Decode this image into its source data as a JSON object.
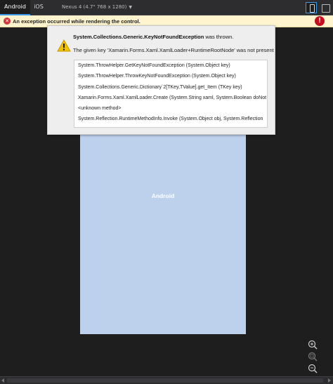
{
  "tabs": {
    "android": "Android",
    "ios": "iOS"
  },
  "device_selector": {
    "value": "Nexus 4 (4.7\" 768 x 1280)"
  },
  "banner": {
    "message": "An exception occurred while rendering the control."
  },
  "dialog": {
    "exception_type": "System.Collections.Generic.KeyNotFoundException",
    "title_suffix": " was thrown.",
    "message": "The given key 'Xamarin.Forms.Xaml.XamlLoader+RuntimeRootNode' was not present",
    "stack_trace": [
      "System.ThrowHelper.GetKeyNotFoundException (System.Object key)",
      "System.ThrowHelper.ThrowKeyNotFoundException (System.Object key)",
      "System.Collections.Generic.Dictionary`2[TKey,TValue].get_Item (TKey key)",
      "Xamarin.Forms.Xaml.XamlLoader.Create (System.String xaml, System.Boolean doNot",
      "<unknown method>",
      "System.Reflection.RuntimeMethodInfo.Invoke (System.Object obj, System.Reflection"
    ]
  },
  "preview": {
    "label": "Android",
    "background": "#bdd0ec"
  },
  "colors": {
    "accent": "#3d9ae8",
    "error": "#d13438",
    "banner_bg": "#fff4ce"
  },
  "icons": {
    "banner": "error-circle-icon",
    "dialog": "warning-triangle-icon",
    "zoom_in": "zoom-in-icon",
    "zoom_fit": "zoom-fit-icon",
    "zoom_out": "zoom-out-icon"
  }
}
